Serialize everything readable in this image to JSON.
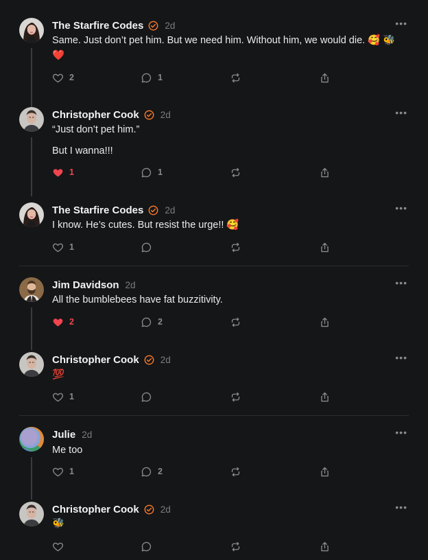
{
  "colors": {
    "background": "#151618",
    "accent": "#f2762b",
    "like": "#f0454f",
    "muted": "#8a8b8e"
  },
  "posts": [
    {
      "author": "The Starfire Codes",
      "time": "2d",
      "line1": "Same. Just don’t pet him. But we need him. Without him, we would die. 🥰 🐝",
      "line2": "❤️",
      "likes": "2",
      "replies": "1",
      "liked": false,
      "verified": true,
      "avatar": "woman-avatar"
    },
    {
      "author": "Christopher Cook",
      "time": "2d",
      "line1": "“Just don’t pet him.”",
      "line2": "But I wanna!!!",
      "likes": "1",
      "replies": "1",
      "liked": true,
      "verified": true,
      "avatar": "man-avatar"
    },
    {
      "author": "The Starfire Codes",
      "time": "2d",
      "line1": "I know. He’s cutes. But resist the urge!! 🥰",
      "likes": "1",
      "replies": "",
      "liked": false,
      "verified": true,
      "avatar": "woman-avatar"
    },
    {
      "author": "Jim Davidson",
      "time": "2d",
      "line1": "All the bumblebees have fat buzzitivity.",
      "likes": "2",
      "replies": "2",
      "liked": true,
      "verified": false,
      "avatar": "bearded-man-avatar"
    },
    {
      "author": "Christopher Cook",
      "time": "2d",
      "line1": "💯",
      "likes": "1",
      "replies": "",
      "liked": false,
      "verified": true,
      "avatar": "man-avatar"
    },
    {
      "author": "Julie",
      "time": "2d",
      "line1": "Me too",
      "likes": "1",
      "replies": "2",
      "liked": false,
      "verified": false,
      "avatar": "gradient-avatar"
    },
    {
      "author": "Christopher Cook",
      "time": "2d",
      "line1": "🐝",
      "likes": "",
      "replies": "",
      "liked": false,
      "verified": true,
      "avatar": "man-avatar"
    }
  ]
}
